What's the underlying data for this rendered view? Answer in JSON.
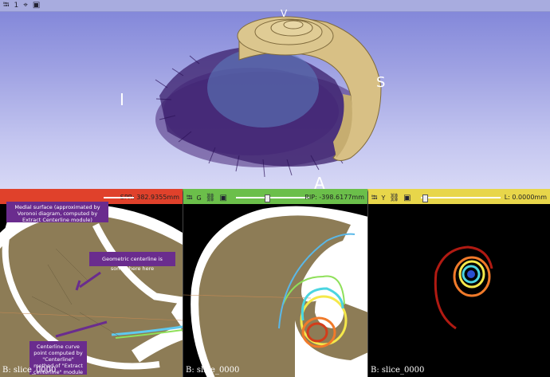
{
  "view3d": {
    "toolbar": {
      "pin_icon": "pin-icon",
      "layout_number": "1",
      "crosshair_icon": "crosshair-icon",
      "maximize_icon": "window-icon"
    },
    "orientation": {
      "inferior": "I",
      "superior": "S",
      "anterior": "A",
      "top": "V"
    }
  },
  "red_view": {
    "color": "#e0412b",
    "offset_label": "SPR: 382.9355mm",
    "bottom_label": "B: slice_0000",
    "callouts": {
      "medial": "Medial surface (approximated by Voronoi diagram, computed by Extract Centerline module)",
      "geometric": "Geometric centerline is somewhere here",
      "curve": "Centerline curve point computed by \"Centerline\" method of \"Extract centerline\" module"
    }
  },
  "green_view": {
    "color": "#6bbf4a",
    "letter": "G",
    "offset_label": "RIP: -398.6177mm",
    "bottom_label": "B: slice_0000"
  },
  "yellow_view": {
    "color": "#e8d64a",
    "letter": "Y",
    "offset_label": "L: 0.0000mm",
    "bottom_label": "B: slice_0000"
  }
}
